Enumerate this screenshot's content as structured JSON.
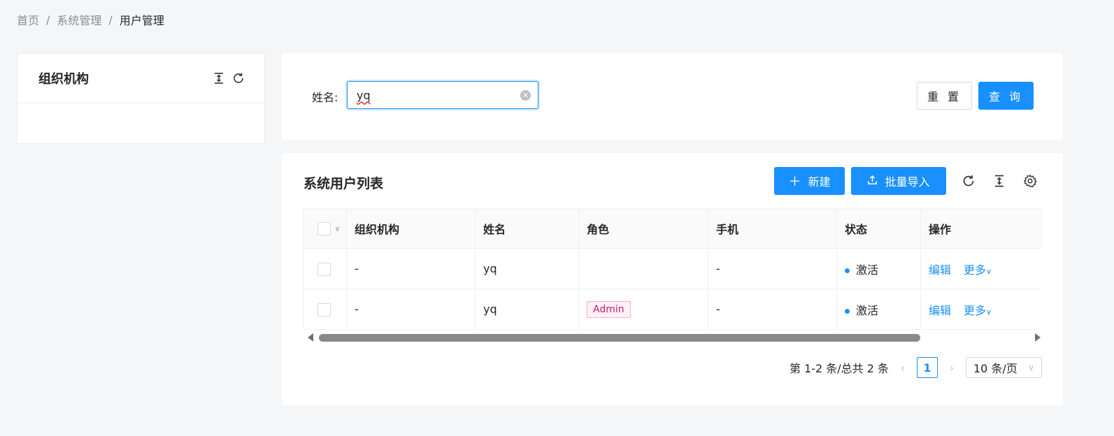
{
  "breadcrumb": [
    "首页",
    "系统管理",
    "用户管理"
  ],
  "breadcrumb_separator": "/",
  "org_panel": {
    "title": "组织机构"
  },
  "search": {
    "label": "姓名:",
    "value": "yq",
    "reset_label": "重 置",
    "query_label": "查 询"
  },
  "list": {
    "title": "系统用户列表",
    "new_label": "新建",
    "import_label": "批量导入",
    "columns": [
      "组织机构",
      "姓名",
      "角色",
      "手机",
      "状态",
      "操作"
    ],
    "rows": [
      {
        "org": "-",
        "name": "yq",
        "role": "",
        "phone": "-",
        "status": "激活",
        "edit": "编辑",
        "more": "更多"
      },
      {
        "org": "-",
        "name": "yq",
        "role": "Admin",
        "phone": "-",
        "status": "激活",
        "edit": "编辑",
        "more": "更多"
      }
    ]
  },
  "pagination": {
    "summary": "第 1-2 条/总共 2 条",
    "current_page": "1",
    "page_size": "10 条/页"
  },
  "colors": {
    "primary": "#1890ff",
    "tag_text": "#c41d7f",
    "tag_bg": "#fff0f6"
  }
}
